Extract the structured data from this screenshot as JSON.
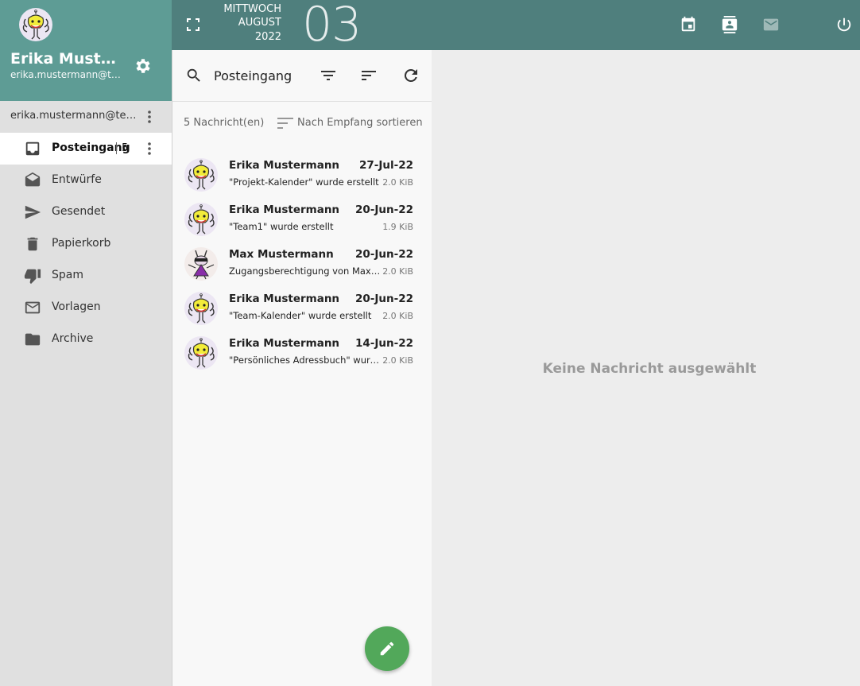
{
  "colors": {
    "header_teal": "#5e9c95",
    "topbar_teal": "#4f7f7d",
    "compose_green": "#52a85a",
    "sidebar_bg": "#e0e0e0"
  },
  "account": {
    "name": "Erika Muster...",
    "email": "erika.mustermann@tes...",
    "account_label": "erika.mustermann@test..."
  },
  "folders": [
    {
      "label": "Posteingang",
      "icon": "inbox-icon",
      "count": "5",
      "active": true
    },
    {
      "label": "Entwürfe",
      "icon": "drafts-icon"
    },
    {
      "label": "Gesendet",
      "icon": "send-icon"
    },
    {
      "label": "Papierkorb",
      "icon": "trash-icon"
    },
    {
      "label": "Spam",
      "icon": "thumb-down-icon"
    },
    {
      "label": "Vorlagen",
      "icon": "mail-icon"
    },
    {
      "label": "Archive",
      "icon": "folder-icon"
    }
  ],
  "topbar": {
    "weekday": "MITTWOCH",
    "month": "AUGUST",
    "year": "2022",
    "day": "03",
    "icons": [
      "fullscreen-icon",
      "calendar-icon",
      "contacts-icon",
      "mail-icon",
      "power-icon"
    ]
  },
  "list": {
    "search_value": "Posteingang",
    "count_text": "5 Nachricht(en)",
    "sort_label": "Nach Empfang sortieren",
    "messages": [
      {
        "from": "Erika Mustermann",
        "date": "27-Jul-22",
        "subject": "\"Projekt-Kalender\" wurde erstellt",
        "size": "2.0 KiB",
        "avatar": "erika-avatar"
      },
      {
        "from": "Erika Mustermann",
        "date": "20-Jun-22",
        "subject": "\"Team1\" wurde erstellt",
        "size": "1.9 KiB",
        "avatar": "erika-avatar"
      },
      {
        "from": "Max Mustermann",
        "date": "20-Jun-22",
        "subject": "Zugangsberechtigung von Max M...",
        "size": "2.0 KiB",
        "avatar": "max-avatar"
      },
      {
        "from": "Erika Mustermann",
        "date": "20-Jun-22",
        "subject": "\"Team-Kalender\" wurde erstellt",
        "size": "2.0 KiB",
        "avatar": "erika-avatar"
      },
      {
        "from": "Erika Mustermann",
        "date": "14-Jun-22",
        "subject": "\"Persönliches Adressbuch\" wurd...",
        "size": "2.0 KiB",
        "avatar": "erika-avatar"
      }
    ]
  },
  "preview": {
    "empty_text": "Keine Nachricht ausgewählt"
  }
}
